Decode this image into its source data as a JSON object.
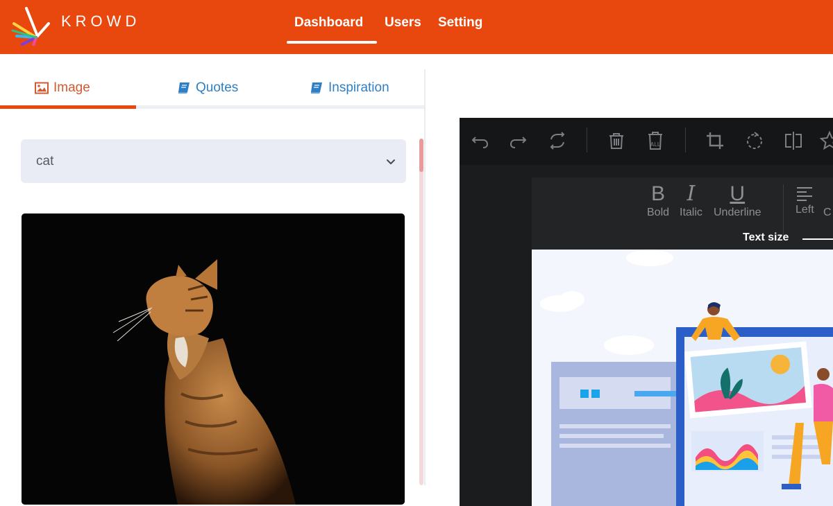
{
  "header": {
    "brand": "KROWD",
    "nav": [
      {
        "label": "Dashboard"
      },
      {
        "label": "Users"
      },
      {
        "label": "Setting"
      }
    ]
  },
  "tabs": [
    {
      "label": "Image",
      "icon": "image-icon"
    },
    {
      "label": "Quotes",
      "icon": "book-icon"
    },
    {
      "label": "Inspiration",
      "icon": "book-icon"
    }
  ],
  "search": {
    "selected": "cat"
  },
  "editor": {
    "format": {
      "bold_glyph": "B",
      "bold": "Bold",
      "italic_glyph": "I",
      "italic": "Italic",
      "underline_glyph": "U",
      "underline": "Underline",
      "left": "Left",
      "center": "C"
    },
    "text_size_label": "Text size"
  },
  "colors": {
    "brand": "#e8470e",
    "active_tab": "#d15a30",
    "link": "#2f7fc4",
    "editor_bg": "#1b1c1e"
  }
}
